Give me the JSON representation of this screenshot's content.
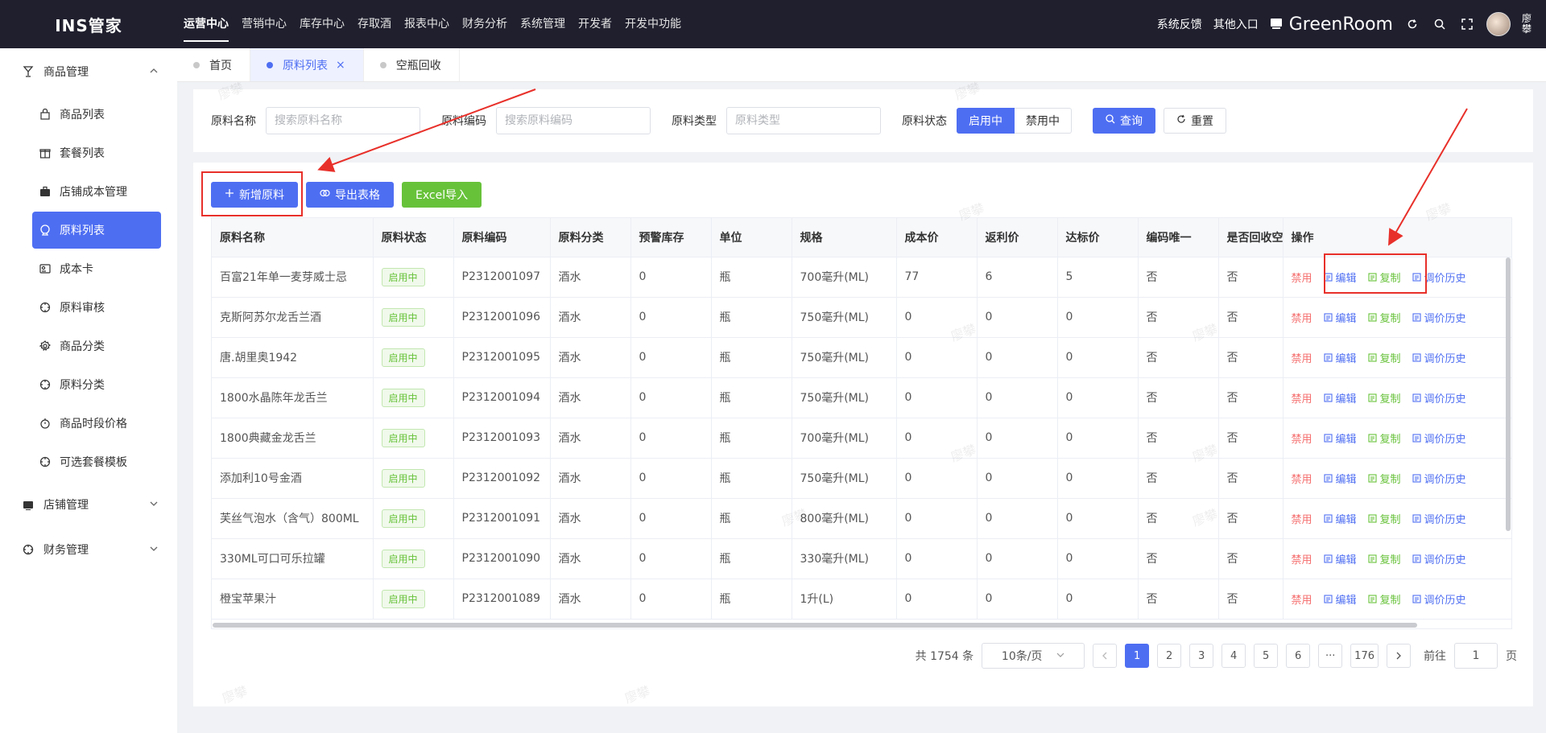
{
  "app": {
    "logo": "INS管家",
    "brand": "GreenRoom",
    "user_name": "廖攀"
  },
  "top_nav": [
    {
      "label": "运营中心",
      "active": true
    },
    {
      "label": "营销中心"
    },
    {
      "label": "库存中心"
    },
    {
      "label": "存取酒"
    },
    {
      "label": "报表中心"
    },
    {
      "label": "财务分析"
    },
    {
      "label": "系统管理"
    },
    {
      "label": "开发者"
    },
    {
      "label": "开发中功能"
    }
  ],
  "top_right": {
    "feedback": "系统反馈",
    "other_entry": "其他入口"
  },
  "sidebar": {
    "groups": [
      {
        "label": "商品管理",
        "icon": "goblet-icon",
        "expanded": true
      },
      {
        "label": "店铺管理",
        "icon": "shop-icon",
        "expanded": false
      },
      {
        "label": "财务管理",
        "icon": "finance-icon",
        "expanded": false
      }
    ],
    "items": [
      {
        "label": "商品列表",
        "icon": "bag-icon"
      },
      {
        "label": "套餐列表",
        "icon": "gift-icon"
      },
      {
        "label": "店铺成本管理",
        "icon": "briefcase-icon"
      },
      {
        "label": "原料列表",
        "icon": "ingredient-icon",
        "active": true
      },
      {
        "label": "成本卡",
        "icon": "card-icon"
      },
      {
        "label": "原料审核",
        "icon": "audit-icon"
      },
      {
        "label": "商品分类",
        "icon": "settings-icon"
      },
      {
        "label": "原料分类",
        "icon": "category-icon"
      },
      {
        "label": "商品时段价格",
        "icon": "timer-icon"
      },
      {
        "label": "可选套餐模板",
        "icon": "template-icon"
      }
    ]
  },
  "tabs": [
    {
      "label": "首页"
    },
    {
      "label": "原料列表",
      "active": true,
      "close": "×"
    },
    {
      "label": "空瓶回收"
    }
  ],
  "search": {
    "name_label": "原料名称",
    "name_placeholder": "搜索原料名称",
    "code_label": "原料编码",
    "code_placeholder": "搜索原料编码",
    "type_label": "原料类型",
    "type_placeholder": "原料类型",
    "status_label": "原料状态",
    "status_on": "启用中",
    "status_off": "禁用中",
    "query": "查询",
    "reset": "重置"
  },
  "toolbar": {
    "add": "新增原料",
    "export": "导出表格",
    "import": "Excel导入"
  },
  "table": {
    "columns": [
      "原料名称",
      "原料状态",
      "原料编码",
      "原料分类",
      "预警库存",
      "单位",
      "规格",
      "成本价",
      "返利价",
      "达标价",
      "编码唯一",
      "是否回收空",
      "操作"
    ],
    "rows": [
      {
        "name": "百富21年单一麦芽威士忌",
        "status": "启用中",
        "code": "P2312001097",
        "category": "酒水",
        "warn": "0",
        "unit": "瓶",
        "spec": "700毫升(ML)",
        "cost": "77",
        "rebate": "6",
        "target": "5",
        "unique": "否",
        "recycle": "否"
      },
      {
        "name": "克斯阿苏尔龙舌兰酒",
        "status": "启用中",
        "code": "P2312001096",
        "category": "酒水",
        "warn": "0",
        "unit": "瓶",
        "spec": "750毫升(ML)",
        "cost": "0",
        "rebate": "0",
        "target": "0",
        "unique": "否",
        "recycle": "否"
      },
      {
        "name": "唐.胡里奥1942",
        "status": "启用中",
        "code": "P2312001095",
        "category": "酒水",
        "warn": "0",
        "unit": "瓶",
        "spec": "750毫升(ML)",
        "cost": "0",
        "rebate": "0",
        "target": "0",
        "unique": "否",
        "recycle": "否"
      },
      {
        "name": "1800水晶陈年龙舌兰",
        "status": "启用中",
        "code": "P2312001094",
        "category": "酒水",
        "warn": "0",
        "unit": "瓶",
        "spec": "750毫升(ML)",
        "cost": "0",
        "rebate": "0",
        "target": "0",
        "unique": "否",
        "recycle": "否"
      },
      {
        "name": "1800典藏金龙舌兰",
        "status": "启用中",
        "code": "P2312001093",
        "category": "酒水",
        "warn": "0",
        "unit": "瓶",
        "spec": "700毫升(ML)",
        "cost": "0",
        "rebate": "0",
        "target": "0",
        "unique": "否",
        "recycle": "否"
      },
      {
        "name": "添加利10号金酒",
        "status": "启用中",
        "code": "P2312001092",
        "category": "酒水",
        "warn": "0",
        "unit": "瓶",
        "spec": "750毫升(ML)",
        "cost": "0",
        "rebate": "0",
        "target": "0",
        "unique": "否",
        "recycle": "否"
      },
      {
        "name": "芙丝气泡水（含气）800ML",
        "status": "启用中",
        "code": "P2312001091",
        "category": "酒水",
        "warn": "0",
        "unit": "瓶",
        "spec": "800毫升(ML)",
        "cost": "0",
        "rebate": "0",
        "target": "0",
        "unique": "否",
        "recycle": "否"
      },
      {
        "name": "330ML可口可乐拉罐",
        "status": "启用中",
        "code": "P2312001090",
        "category": "酒水",
        "warn": "0",
        "unit": "瓶",
        "spec": "330毫升(ML)",
        "cost": "0",
        "rebate": "0",
        "target": "0",
        "unique": "否",
        "recycle": "否"
      },
      {
        "name": "橙宝苹果汁",
        "status": "启用中",
        "code": "P2312001089",
        "category": "酒水",
        "warn": "0",
        "unit": "瓶",
        "spec": "1升(L)",
        "cost": "0",
        "rebate": "0",
        "target": "0",
        "unique": "否",
        "recycle": "否"
      }
    ],
    "ops": {
      "disable": "禁用",
      "edit": "编辑",
      "copy": "复制",
      "history": "调价历史"
    }
  },
  "pagination": {
    "total": "共 1754 条",
    "page_size": "10条/页",
    "pages": [
      "1",
      "2",
      "3",
      "4",
      "5",
      "6",
      "···",
      "176"
    ],
    "current": "1",
    "goto_label": "前往",
    "goto_value": "1",
    "page_suffix": "页"
  },
  "watermark": "廖攀",
  "colors": {
    "primary": "#4e6ef2",
    "topbar": "#1f1f2e",
    "success": "#67c23a",
    "danger": "#f56c6c",
    "annotation": "#e8302a"
  }
}
